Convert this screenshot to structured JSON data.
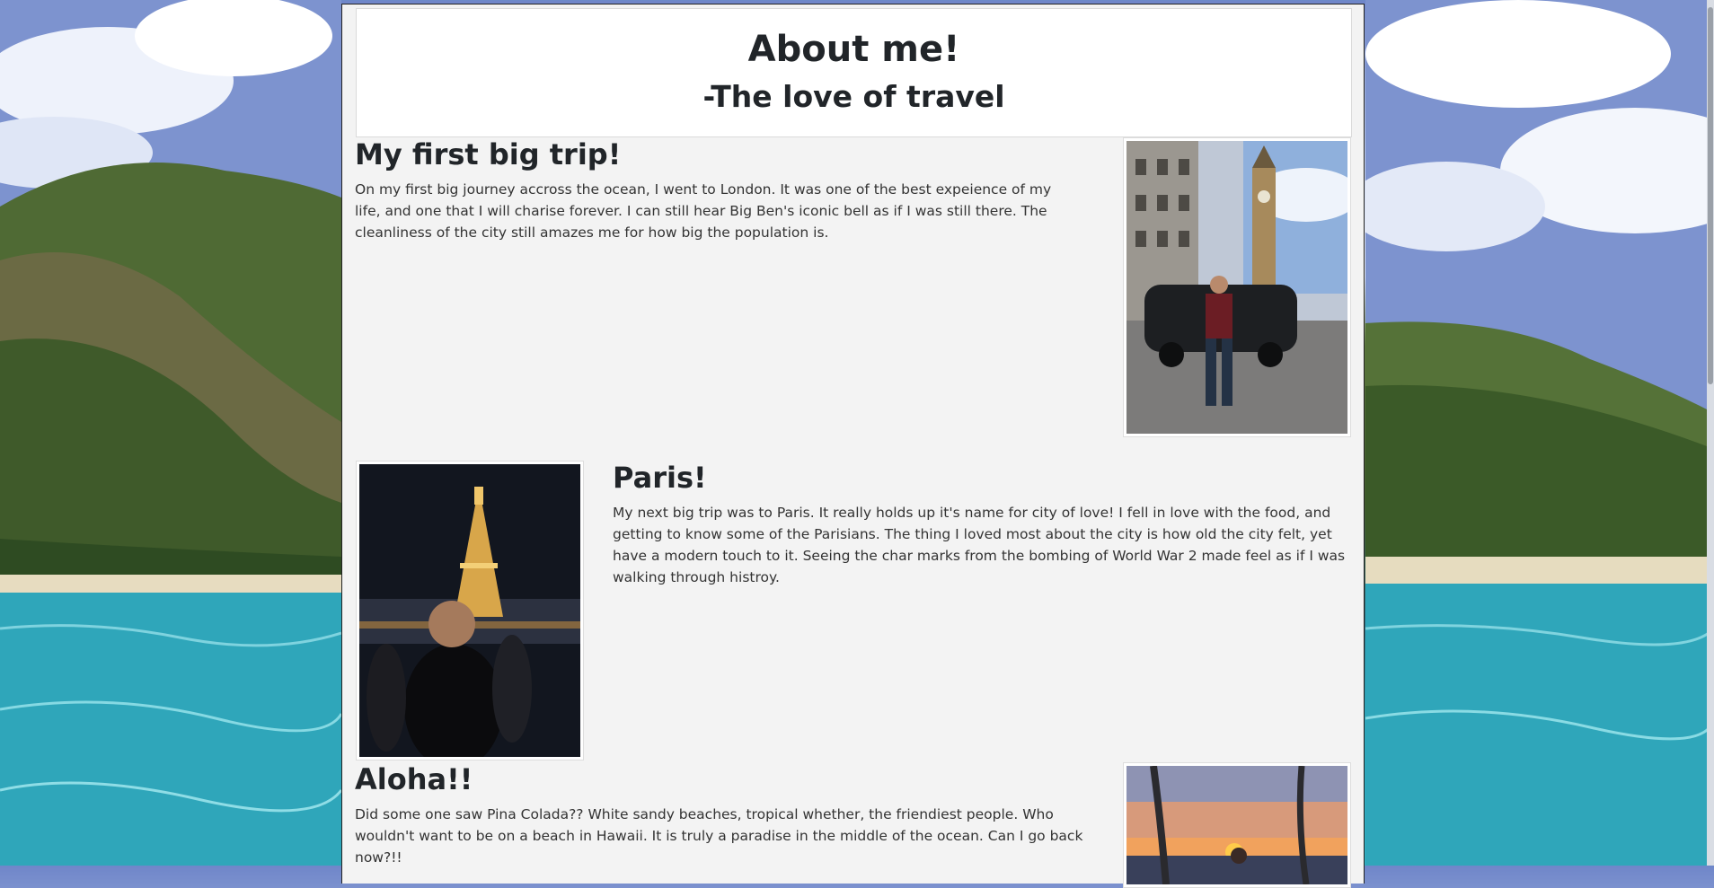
{
  "header": {
    "title": "About me!",
    "subtitle": "-The love of travel"
  },
  "sections": [
    {
      "title": "My first big trip!",
      "text": "On my first big journey accross the ocean, I went to London. It was one of the best expeience of my life, and one that I will charise forever. I can still hear Big Ben's iconic bell as if I was still there. The cleanliness of the city still amazes me for how big the population is.",
      "image_icon": "london-photo"
    },
    {
      "title": "Paris!",
      "text": "My next big trip was to Paris. It really holds up it's name for city of love! I fell in love with the food, and getting to know some of the Parisians. The thing I loved most about the city is how old the city felt, yet have a modern touch to it. Seeing the char marks from the bombing of World War 2 made feel as if I was walking through histroy.",
      "image_icon": "paris-photo"
    },
    {
      "title": "Aloha!!",
      "text": "Did some one saw Pina Colada?? White sandy beaches, tropical whether, the friendiest people. Who wouldn't want to be on a beach in Hawaii. It is truly a paradise in the middle of the ocean. Can I go back now?!!",
      "image_icon": "hawaii-photo"
    }
  ],
  "colors": {
    "page_panel": "#f3f3f3",
    "header_bg": "#ffffff",
    "heading": "#212529"
  }
}
